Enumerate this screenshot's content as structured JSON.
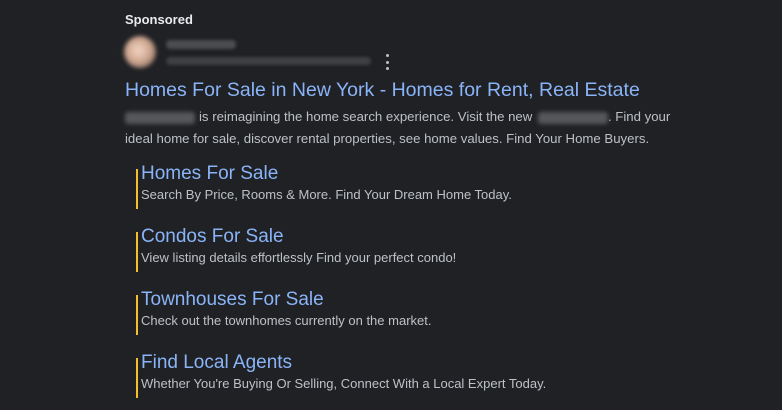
{
  "ad": {
    "sponsored_label": "Sponsored",
    "headline": "Homes For Sale in New York - Homes for Rent, Real Estate",
    "description": {
      "part1": "is reimagining the home search experience. Visit the new",
      "part2": ". Find your ideal home for sale, discover rental properties, see home values. Find Your Home Buyers."
    },
    "menu_icon": "three-dot-vertical-icon",
    "colors": {
      "background": "#202124",
      "link": "#8ab4f8",
      "text": "#bdc1c6",
      "sitelink_bar": "#f5bf2b"
    }
  },
  "sitelinks": [
    {
      "title": "Homes For Sale",
      "description": "Search By Price, Rooms & More. Find Your Dream Home Today."
    },
    {
      "title": "Condos For Sale",
      "description": "View listing details effortlessly Find your perfect condo!"
    },
    {
      "title": "Townhouses For Sale",
      "description": "Check out the townhomes currently on the market."
    },
    {
      "title": "Find Local Agents",
      "description": "Whether You're Buying Or Selling, Connect With a Local Expert Today."
    }
  ]
}
